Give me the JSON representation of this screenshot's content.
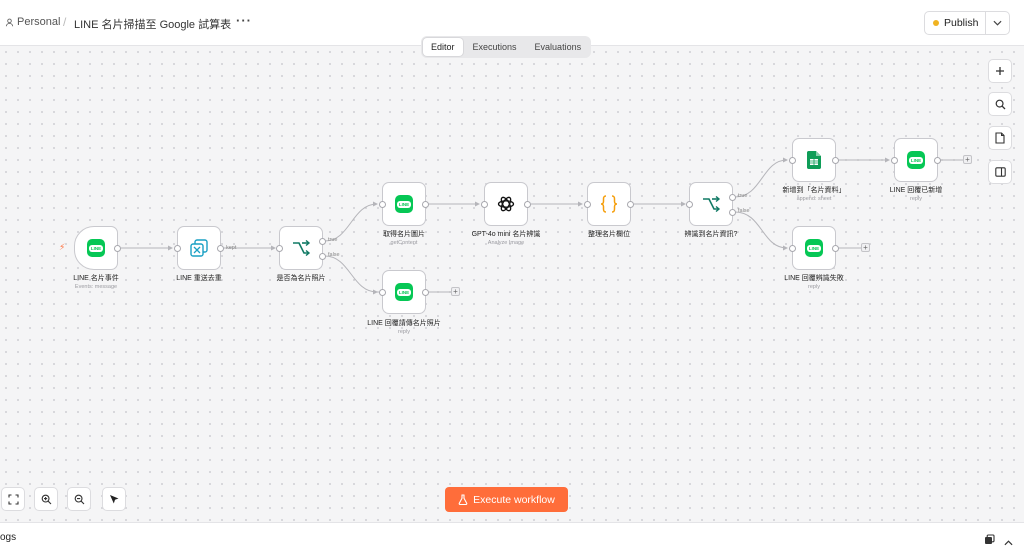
{
  "header": {
    "breadcrumb_user": "Personal",
    "separator": "/",
    "workflow_title": "LINE 名片掃描至 Google 試算表",
    "more_label": "···",
    "publish_label": "Publish",
    "publish_status_color": "#f0b322"
  },
  "tabs": [
    {
      "label": "Editor",
      "active": true
    },
    {
      "label": "Executions",
      "active": false
    },
    {
      "label": "Evaluations",
      "active": false
    }
  ],
  "nodes": {
    "line_event": {
      "label": "LINE 名片事件",
      "sub": "Events: message",
      "icon": "line-icon"
    },
    "dedupe": {
      "label": "LINE 重送去重",
      "sub": "",
      "icon": "dedupe-icon",
      "port_label": "kept"
    },
    "is_photo": {
      "label": "是否為名片照片",
      "sub": "",
      "icon": "branch-icon",
      "true_label": "true",
      "false_label": "false"
    },
    "get_image": {
      "label": "取得名片圖片",
      "sub": "getContent",
      "icon": "line-icon"
    },
    "reply_send_photo": {
      "label": "LINE 回覆請傳名片照片",
      "sub": "reply",
      "icon": "line-icon"
    },
    "gpt": {
      "label": "GPT-4o mini 名片辨識",
      "sub": "Analyze Image",
      "icon": "openai-icon"
    },
    "format": {
      "label": "整理名片欄位",
      "sub": "",
      "icon": "code-braces-icon"
    },
    "recognized": {
      "label": "辨識到名片資訊?",
      "sub": "",
      "icon": "branch-icon",
      "true_label": "true",
      "false_label": "false"
    },
    "append_sheet": {
      "label": "新增到「名片資料」",
      "sub": "append: sheet",
      "icon": "google-sheets-icon"
    },
    "reply_added": {
      "label": "LINE 回覆已新增",
      "sub": "reply",
      "icon": "line-icon"
    },
    "reply_failed": {
      "label": "LINE 回覆辨識失敗",
      "sub": "reply",
      "icon": "line-icon"
    }
  },
  "line_logo_text": "LINE",
  "plus_glyph": "+",
  "execute_label": "Execute workflow",
  "logs_label": "ogs",
  "colors": {
    "accent": "#ff6d3a",
    "line_green": "#06c755",
    "sheets_green": "#0f9d58",
    "branch_teal": "#117a65",
    "code_orange": "#f59e0b"
  }
}
